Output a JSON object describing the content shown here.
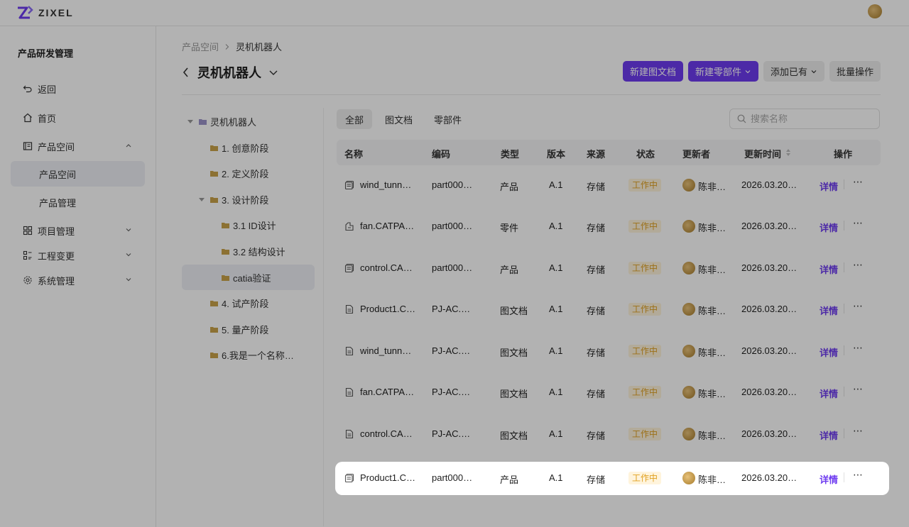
{
  "app": {
    "brand": "ZIXEL"
  },
  "colors": {
    "primary": "#6e3bf0",
    "status_bg": "#fff4dc",
    "status_text": "#e0a020",
    "overlay": "rgba(0,0,0,0.30)"
  },
  "sidebar": {
    "title": "产品研发管理",
    "items": [
      {
        "label": "返回",
        "icon": "back-icon"
      },
      {
        "label": "首页",
        "icon": "home-icon"
      },
      {
        "label": "产品空间",
        "icon": "product-space-icon",
        "expanded": true
      },
      {
        "label": "产品空间",
        "sub": true,
        "active": true
      },
      {
        "label": "产品管理",
        "sub": true
      },
      {
        "label": "项目管理",
        "icon": "project-icon"
      },
      {
        "label": "工程变更",
        "icon": "change-icon"
      },
      {
        "label": "系统管理",
        "icon": "settings-icon"
      }
    ]
  },
  "breadcrumb": {
    "parent": "产品空间",
    "current": "灵机机器人"
  },
  "header": {
    "title": "灵机机器人",
    "buttons": {
      "new_doc": "新建图文档",
      "new_part": "新建零部件",
      "add_existing": "添加已有",
      "batch": "批量操作"
    }
  },
  "tree": [
    {
      "label": "灵机机器人",
      "level": 0
    },
    {
      "label": "1. 创意阶段",
      "level": 1
    },
    {
      "label": "2. 定义阶段",
      "level": 1
    },
    {
      "label": "3. 设计阶段",
      "level": 1
    },
    {
      "label": "3.1 ID设计",
      "level": 2
    },
    {
      "label": "3.2 结构设计",
      "level": 2
    },
    {
      "label": "catia验证",
      "level": 2,
      "active": true
    },
    {
      "label": "4. 试产阶段",
      "level": 1
    },
    {
      "label": "5. 量产阶段",
      "level": 1
    },
    {
      "label": "6.我是一个名称…",
      "level": 1
    }
  ],
  "tabs": [
    "全部",
    "图文档",
    "零部件"
  ],
  "search": {
    "placeholder": "搜索名称"
  },
  "table": {
    "columns": [
      "名称",
      "编码",
      "类型",
      "版本",
      "来源",
      "状态",
      "更新者",
      "更新时间",
      "操作"
    ],
    "rows": [
      {
        "name": "wind_tunn…",
        "icon": "product-icon",
        "code": "part000…",
        "type": "产品",
        "version": "A.1",
        "source": "存储",
        "status": "工作中",
        "user": "陈非…",
        "time": "2026.03.20…",
        "action": "详情"
      },
      {
        "name": "fan.CATPA…",
        "icon": "part-icon",
        "code": "part000…",
        "type": "零件",
        "version": "A.1",
        "source": "存储",
        "status": "工作中",
        "user": "陈非…",
        "time": "2026.03.20…",
        "action": "详情"
      },
      {
        "name": "control.CA…",
        "icon": "product-icon",
        "code": "part000…",
        "type": "产品",
        "version": "A.1",
        "source": "存储",
        "status": "工作中",
        "user": "陈非…",
        "time": "2026.03.20…",
        "action": "详情"
      },
      {
        "name": "Product1.C…",
        "icon": "document-icon",
        "code": "PJ-AC.…",
        "type": "图文档",
        "version": "A.1",
        "source": "存储",
        "status": "工作中",
        "user": "陈非…",
        "time": "2026.03.20…",
        "action": "详情"
      },
      {
        "name": "wind_tunn…",
        "icon": "document-icon",
        "code": "PJ-AC.…",
        "type": "图文档",
        "version": "A.1",
        "source": "存储",
        "status": "工作中",
        "user": "陈非…",
        "time": "2026.03.20…",
        "action": "详情"
      },
      {
        "name": "fan.CATPA…",
        "icon": "document-icon",
        "code": "PJ-AC.…",
        "type": "图文档",
        "version": "A.1",
        "source": "存储",
        "status": "工作中",
        "user": "陈非…",
        "time": "2026.03.20…",
        "action": "详情"
      },
      {
        "name": "control.CA…",
        "icon": "document-icon",
        "code": "PJ-AC.…",
        "type": "图文档",
        "version": "A.1",
        "source": "存储",
        "status": "工作中",
        "user": "陈非…",
        "time": "2026.03.20…",
        "action": "详情"
      },
      {
        "name": "Product1.C…",
        "icon": "product-icon",
        "code": "part000…",
        "type": "产品",
        "version": "A.1",
        "source": "存储",
        "status": "工作中",
        "user": "陈非…",
        "time": "2026.03.20…",
        "action": "详情",
        "highlighted": true
      }
    ]
  }
}
